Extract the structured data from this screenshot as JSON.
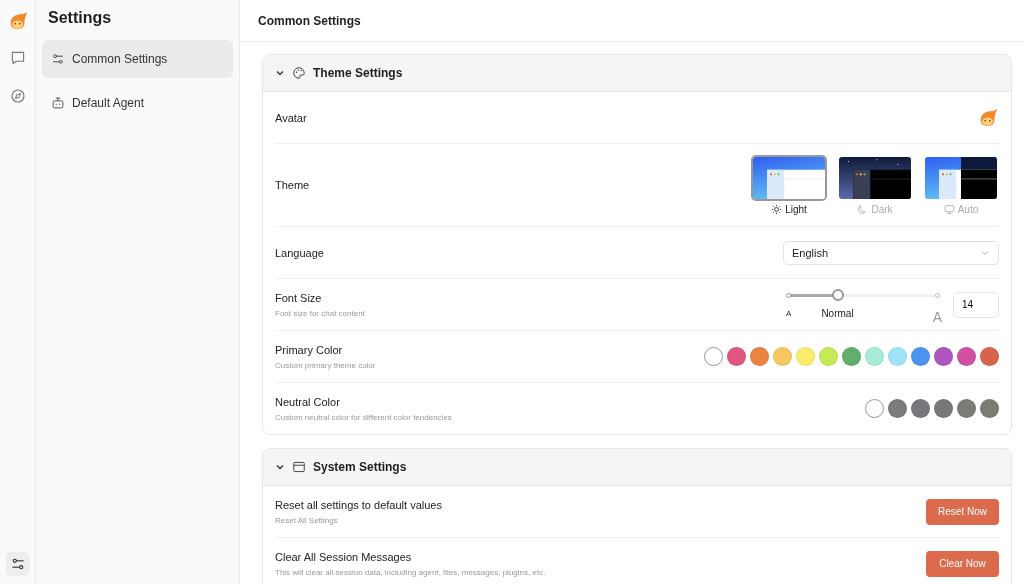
{
  "rail": {
    "items": [
      {
        "kind": "chat",
        "selected": false
      },
      {
        "kind": "discover",
        "selected": false
      },
      {
        "kind": "settings",
        "selected": true
      }
    ]
  },
  "sidebar": {
    "title": "Settings",
    "items": [
      {
        "label": "Common Settings",
        "kind": "sliders",
        "selected": true
      },
      {
        "label": "Default Agent",
        "kind": "robot",
        "selected": false
      }
    ]
  },
  "header": {
    "title": "Common Settings"
  },
  "sections": [
    {
      "title": "Theme Settings",
      "kind": "palette",
      "expanded": true,
      "rows": [
        {
          "kind": "avatar",
          "label": "Avatar"
        },
        {
          "kind": "theme",
          "label": "Theme",
          "options": [
            {
              "label": "Light",
              "kind": "light",
              "selected": true
            },
            {
              "label": "Dark",
              "kind": "dark",
              "selected": false
            },
            {
              "label": "Auto",
              "kind": "auto",
              "selected": false
            }
          ]
        },
        {
          "kind": "select",
          "label": "Language",
          "value": "English"
        },
        {
          "kind": "slider",
          "label": "Font Size",
          "description": "Font size for chat content",
          "level": 0.33,
          "min_label": "A",
          "mark_label": "Normal",
          "max_label": "A",
          "value": "14"
        },
        {
          "kind": "swatches",
          "label": "Primary Color",
          "description": "Custom primary theme color",
          "swatches": [
            {
              "color": "#ffffff",
              "selected": true
            },
            {
              "color": "#e0567e",
              "selected": false
            },
            {
              "color": "#ed8341",
              "selected": false
            },
            {
              "color": "#f6c85f",
              "selected": false
            },
            {
              "color": "#faec6c",
              "selected": false
            },
            {
              "color": "#c6e955",
              "selected": false
            },
            {
              "color": "#63ae6a",
              "selected": false
            },
            {
              "color": "#a6ecd9",
              "selected": false
            },
            {
              "color": "#9ee3f9",
              "selected": false
            },
            {
              "color": "#4e92f0",
              "selected": false
            },
            {
              "color": "#ad55c0",
              "selected": false
            },
            {
              "color": "#d24fa2",
              "selected": false
            },
            {
              "color": "#d9634a",
              "selected": false
            }
          ]
        },
        {
          "kind": "swatches",
          "label": "Neutral Color",
          "description": "Custom neutral color for different color tendencies",
          "swatches": [
            {
              "color": "#ffffff",
              "selected": true
            },
            {
              "color": "#7b7a7e",
              "selected": false
            },
            {
              "color": "#77787b",
              "selected": false
            },
            {
              "color": "#757a75",
              "selected": false
            },
            {
              "color": "#7a7c76",
              "selected": false
            },
            {
              "color": "#7c7c74",
              "selected": false
            }
          ]
        }
      ]
    },
    {
      "title": "System Settings",
      "kind": "window",
      "expanded": true,
      "rows": [
        {
          "kind": "button",
          "label": "Reset all settings to default values",
          "description": "Reset All Settings",
          "button": "Reset Now"
        },
        {
          "kind": "button",
          "label": "Clear All Session Messages",
          "description": "This will clear all session data, including agent, files, messages, plugins, etc.",
          "button": "Clear Now"
        }
      ]
    }
  ]
}
